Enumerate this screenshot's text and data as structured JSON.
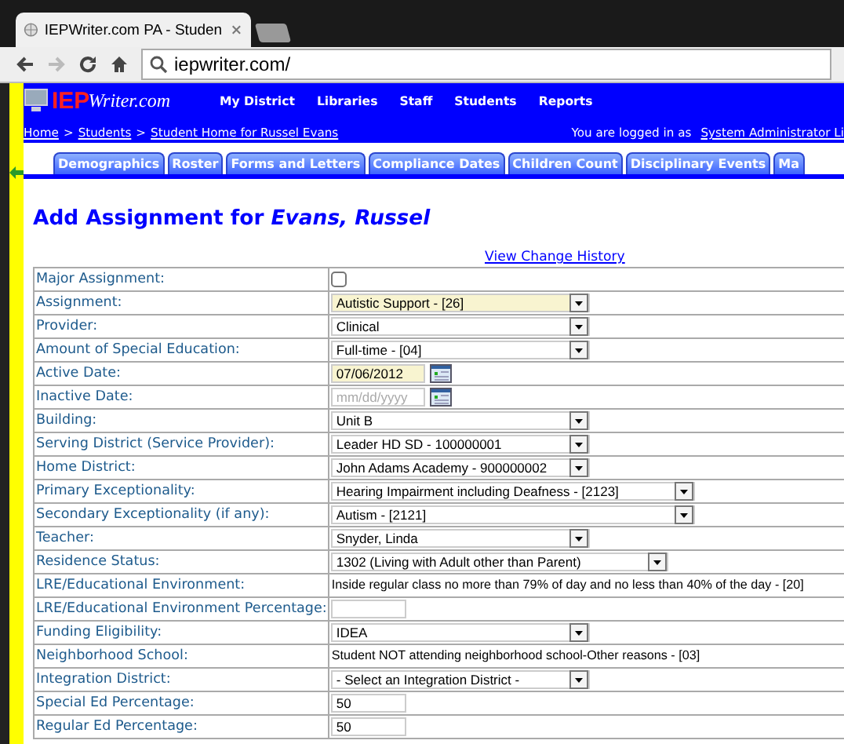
{
  "browser": {
    "tab_title": "IEPWriter.com PA - Studen",
    "address": "iepwriter.com/"
  },
  "header": {
    "logo_iep": "IEP",
    "logo_writer": "Writer.com",
    "nav": [
      "My District",
      "Libraries",
      "Staff",
      "Students",
      "Reports"
    ],
    "breadcrumb": [
      {
        "label": "Home",
        "kind": "link"
      },
      {
        "label": ">",
        "kind": "separator"
      },
      {
        "label": "Students",
        "kind": "link"
      },
      {
        "label": ">",
        "kind": "separator"
      },
      {
        "label": "Student Home for Russel Evans",
        "kind": "link"
      }
    ],
    "logged_in_text": "You are logged in as",
    "user_link": "System Administrator Li"
  },
  "tabs": [
    {
      "label": "Demographics",
      "selected": false
    },
    {
      "label": "Roster",
      "selected": false
    },
    {
      "label": "Forms and Letters",
      "selected": false
    },
    {
      "label": "Compliance Dates",
      "selected": false
    },
    {
      "label": "Children Count",
      "selected": false
    },
    {
      "label": "Disciplinary Events",
      "selected": false
    },
    {
      "label": "Ma",
      "selected": false
    }
  ],
  "title": {
    "prefix": "Add Assignment for",
    "name": "Evans, Russel"
  },
  "history_link": "View Change History",
  "rows": [
    {
      "label": "Major Assignment:",
      "kind": "checkbox",
      "checked": false
    },
    {
      "label": "Assignment:",
      "kind": "select",
      "value": "Autistic Support - [26]",
      "highlighted": true
    },
    {
      "label": "Provider:",
      "kind": "select",
      "value": "Clinical",
      "highlighted": false
    },
    {
      "label": "Amount of Special Education:",
      "kind": "select",
      "value": "Full-time - [04]",
      "highlighted": false
    },
    {
      "label": "Active Date:",
      "kind": "date",
      "value": "07/06/2012",
      "highlighted": true
    },
    {
      "label": "Inactive Date:",
      "kind": "date",
      "placeholder": "mm/dd/yyyy",
      "highlighted": false
    },
    {
      "label": "Building:",
      "kind": "select",
      "value": "Unit B",
      "highlighted": false
    },
    {
      "label": "Serving District (Service Provider):",
      "kind": "select",
      "value": "Leader HD SD - 100000001",
      "highlighted": false
    },
    {
      "label": "Home District:",
      "kind": "select",
      "value": "John Adams Academy - 900000002",
      "highlighted": false
    },
    {
      "label": "Primary Exceptionality:",
      "kind": "wideselect",
      "value": "Hearing Impairment including Deafness - [2123]",
      "highlighted": false
    },
    {
      "label": "Secondary Exceptionality (if any):",
      "kind": "wideselect",
      "value": "Autism - [2121]",
      "highlighted": false
    },
    {
      "label": "Teacher:",
      "kind": "select",
      "value": "Snyder, Linda",
      "highlighted": false
    },
    {
      "label": "Residence Status:",
      "kind": "mediumselect",
      "value": "1302 (Living with Adult other than Parent)",
      "highlighted": false
    },
    {
      "label": "LRE/Educational Environment:",
      "kind": "static",
      "value": "Inside regular class no more than 79% of day and no less than 40% of the day - [20]"
    },
    {
      "label": "LRE/Educational Environment Percentage:",
      "kind": "text",
      "value": "",
      "highlighted": false
    },
    {
      "label": "Funding Eligibility:",
      "kind": "select",
      "value": "IDEA",
      "highlighted": false
    },
    {
      "label": "Neighborhood School:",
      "kind": "static",
      "value": "Student NOT attending neighborhood school-Other reasons - [03]"
    },
    {
      "label": "Integration District:",
      "kind": "select",
      "value": "- Select an Integration District -",
      "highlighted": false
    },
    {
      "label": "Special Ed Percentage:",
      "kind": "text",
      "value": "50",
      "highlighted": false
    },
    {
      "label": "Regular Ed Percentage:",
      "kind": "text",
      "value": "50",
      "highlighted": false
    }
  ]
}
